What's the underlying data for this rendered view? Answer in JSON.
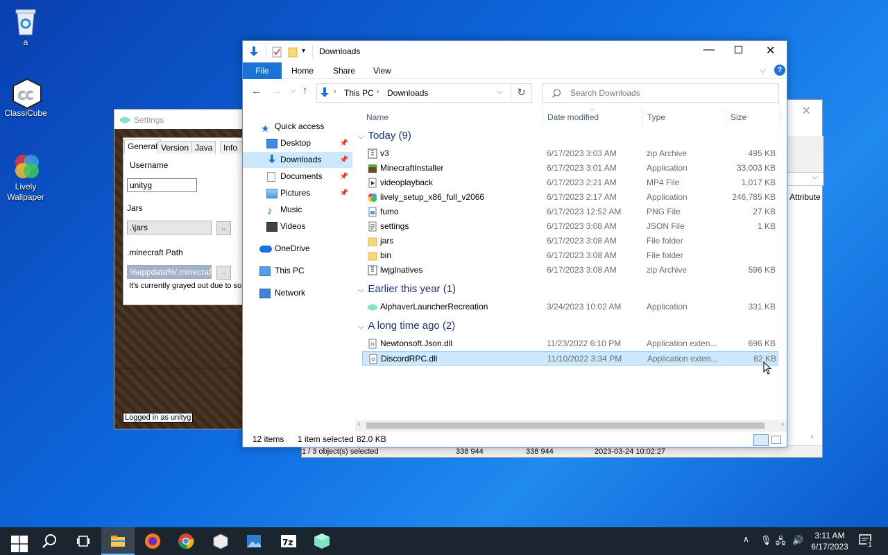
{
  "desktop": {
    "icons": [
      {
        "label": "a",
        "icon": "recycle-bin-icon"
      },
      {
        "label": "ClassiCube",
        "icon": "classicube-icon"
      },
      {
        "label": "Lively Wallpaper",
        "icon": "lively-icon"
      }
    ]
  },
  "zipwin": {
    "attribute_header": "Attribute",
    "status": {
      "selected": "1 / 3 object(s) selected",
      "size": "338 944",
      "packed": "338 944",
      "modified": "2023-03-24 10:02:27"
    }
  },
  "settings": {
    "title": "Settings",
    "tabs": [
      "General",
      "Version",
      "Java",
      "Info"
    ],
    "username_label": "Username",
    "username_value": "unityg",
    "jars_label": "Jars",
    "jars_value": ".\\jars",
    "browse": "..",
    "mcpath_label": ".minecraft Path",
    "mcpath_value": "%appdata%/.minecraft",
    "note": "It's currently grayed out due to som",
    "logged_in": "Logged in as unityg"
  },
  "explorer": {
    "title": "Downloads",
    "ribbon": [
      "File",
      "Home",
      "Share",
      "View"
    ],
    "breadcrumb": [
      "This PC",
      "Downloads"
    ],
    "search_placeholder": "Search Downloads",
    "nav": {
      "quick_access": "Quick access",
      "items": [
        "Desktop",
        "Downloads",
        "Documents",
        "Pictures",
        "Music",
        "Videos"
      ],
      "onedrive": "OneDrive",
      "this_pc": "This PC",
      "network": "Network"
    },
    "columns": [
      "Name",
      "Date modified",
      "Type",
      "Size"
    ],
    "groups": [
      {
        "label": "Today (9)",
        "files": [
          {
            "name": "v3",
            "date": "6/17/2023 3:03 AM",
            "type": "zip Archive",
            "size": "495 KB",
            "icon": "zip"
          },
          {
            "name": "MinecraftInstaller",
            "date": "6/17/2023 3:01 AM",
            "type": "Application",
            "size": "33,003 KB",
            "icon": "mc"
          },
          {
            "name": "videoplayback",
            "date": "6/17/2023 2:21 AM",
            "type": "MP4 File",
            "size": "1,017 KB",
            "icon": "video"
          },
          {
            "name": "lively_setup_x86_full_v2066",
            "date": "6/17/2023 2:17 AM",
            "type": "Application",
            "size": "246,785 KB",
            "icon": "lively"
          },
          {
            "name": "fumo",
            "date": "6/17/2023 12:52 AM",
            "type": "PNG File",
            "size": "27 KB",
            "icon": "png"
          },
          {
            "name": "settings",
            "date": "6/17/2023 3:08 AM",
            "type": "JSON File",
            "size": "1 KB",
            "icon": "json"
          },
          {
            "name": "jars",
            "date": "6/17/2023 3:08 AM",
            "type": "File folder",
            "size": "",
            "icon": "folder"
          },
          {
            "name": "bin",
            "date": "6/17/2023 3:08 AM",
            "type": "File folder",
            "size": "",
            "icon": "folder"
          },
          {
            "name": "lwjglnatives",
            "date": "6/17/2023 3:08 AM",
            "type": "zip Archive",
            "size": "596 KB",
            "icon": "zip"
          }
        ]
      },
      {
        "label": "Earlier this year (1)",
        "files": [
          {
            "name": "AlphaverLauncherRecreation",
            "date": "3/24/2023 10:02 AM",
            "type": "Application",
            "size": "331 KB",
            "icon": "alpha"
          }
        ]
      },
      {
        "label": "A long time ago (2)",
        "files": [
          {
            "name": "Newtonsoft.Json.dll",
            "date": "11/23/2022 6:10 PM",
            "type": "Application exten...",
            "size": "696 KB",
            "icon": "dll"
          },
          {
            "name": "DiscordRPC.dll",
            "date": "11/10/2022 3:34 PM",
            "type": "Application exten...",
            "size": "82 KB",
            "icon": "dll"
          }
        ]
      }
    ],
    "status": {
      "count": "12 items",
      "selected": "1 item selected",
      "size": "82.0 KB"
    }
  },
  "taskbar": {
    "time": "3:11 AM",
    "date": "6/17/2023",
    "notification_count": "1"
  }
}
